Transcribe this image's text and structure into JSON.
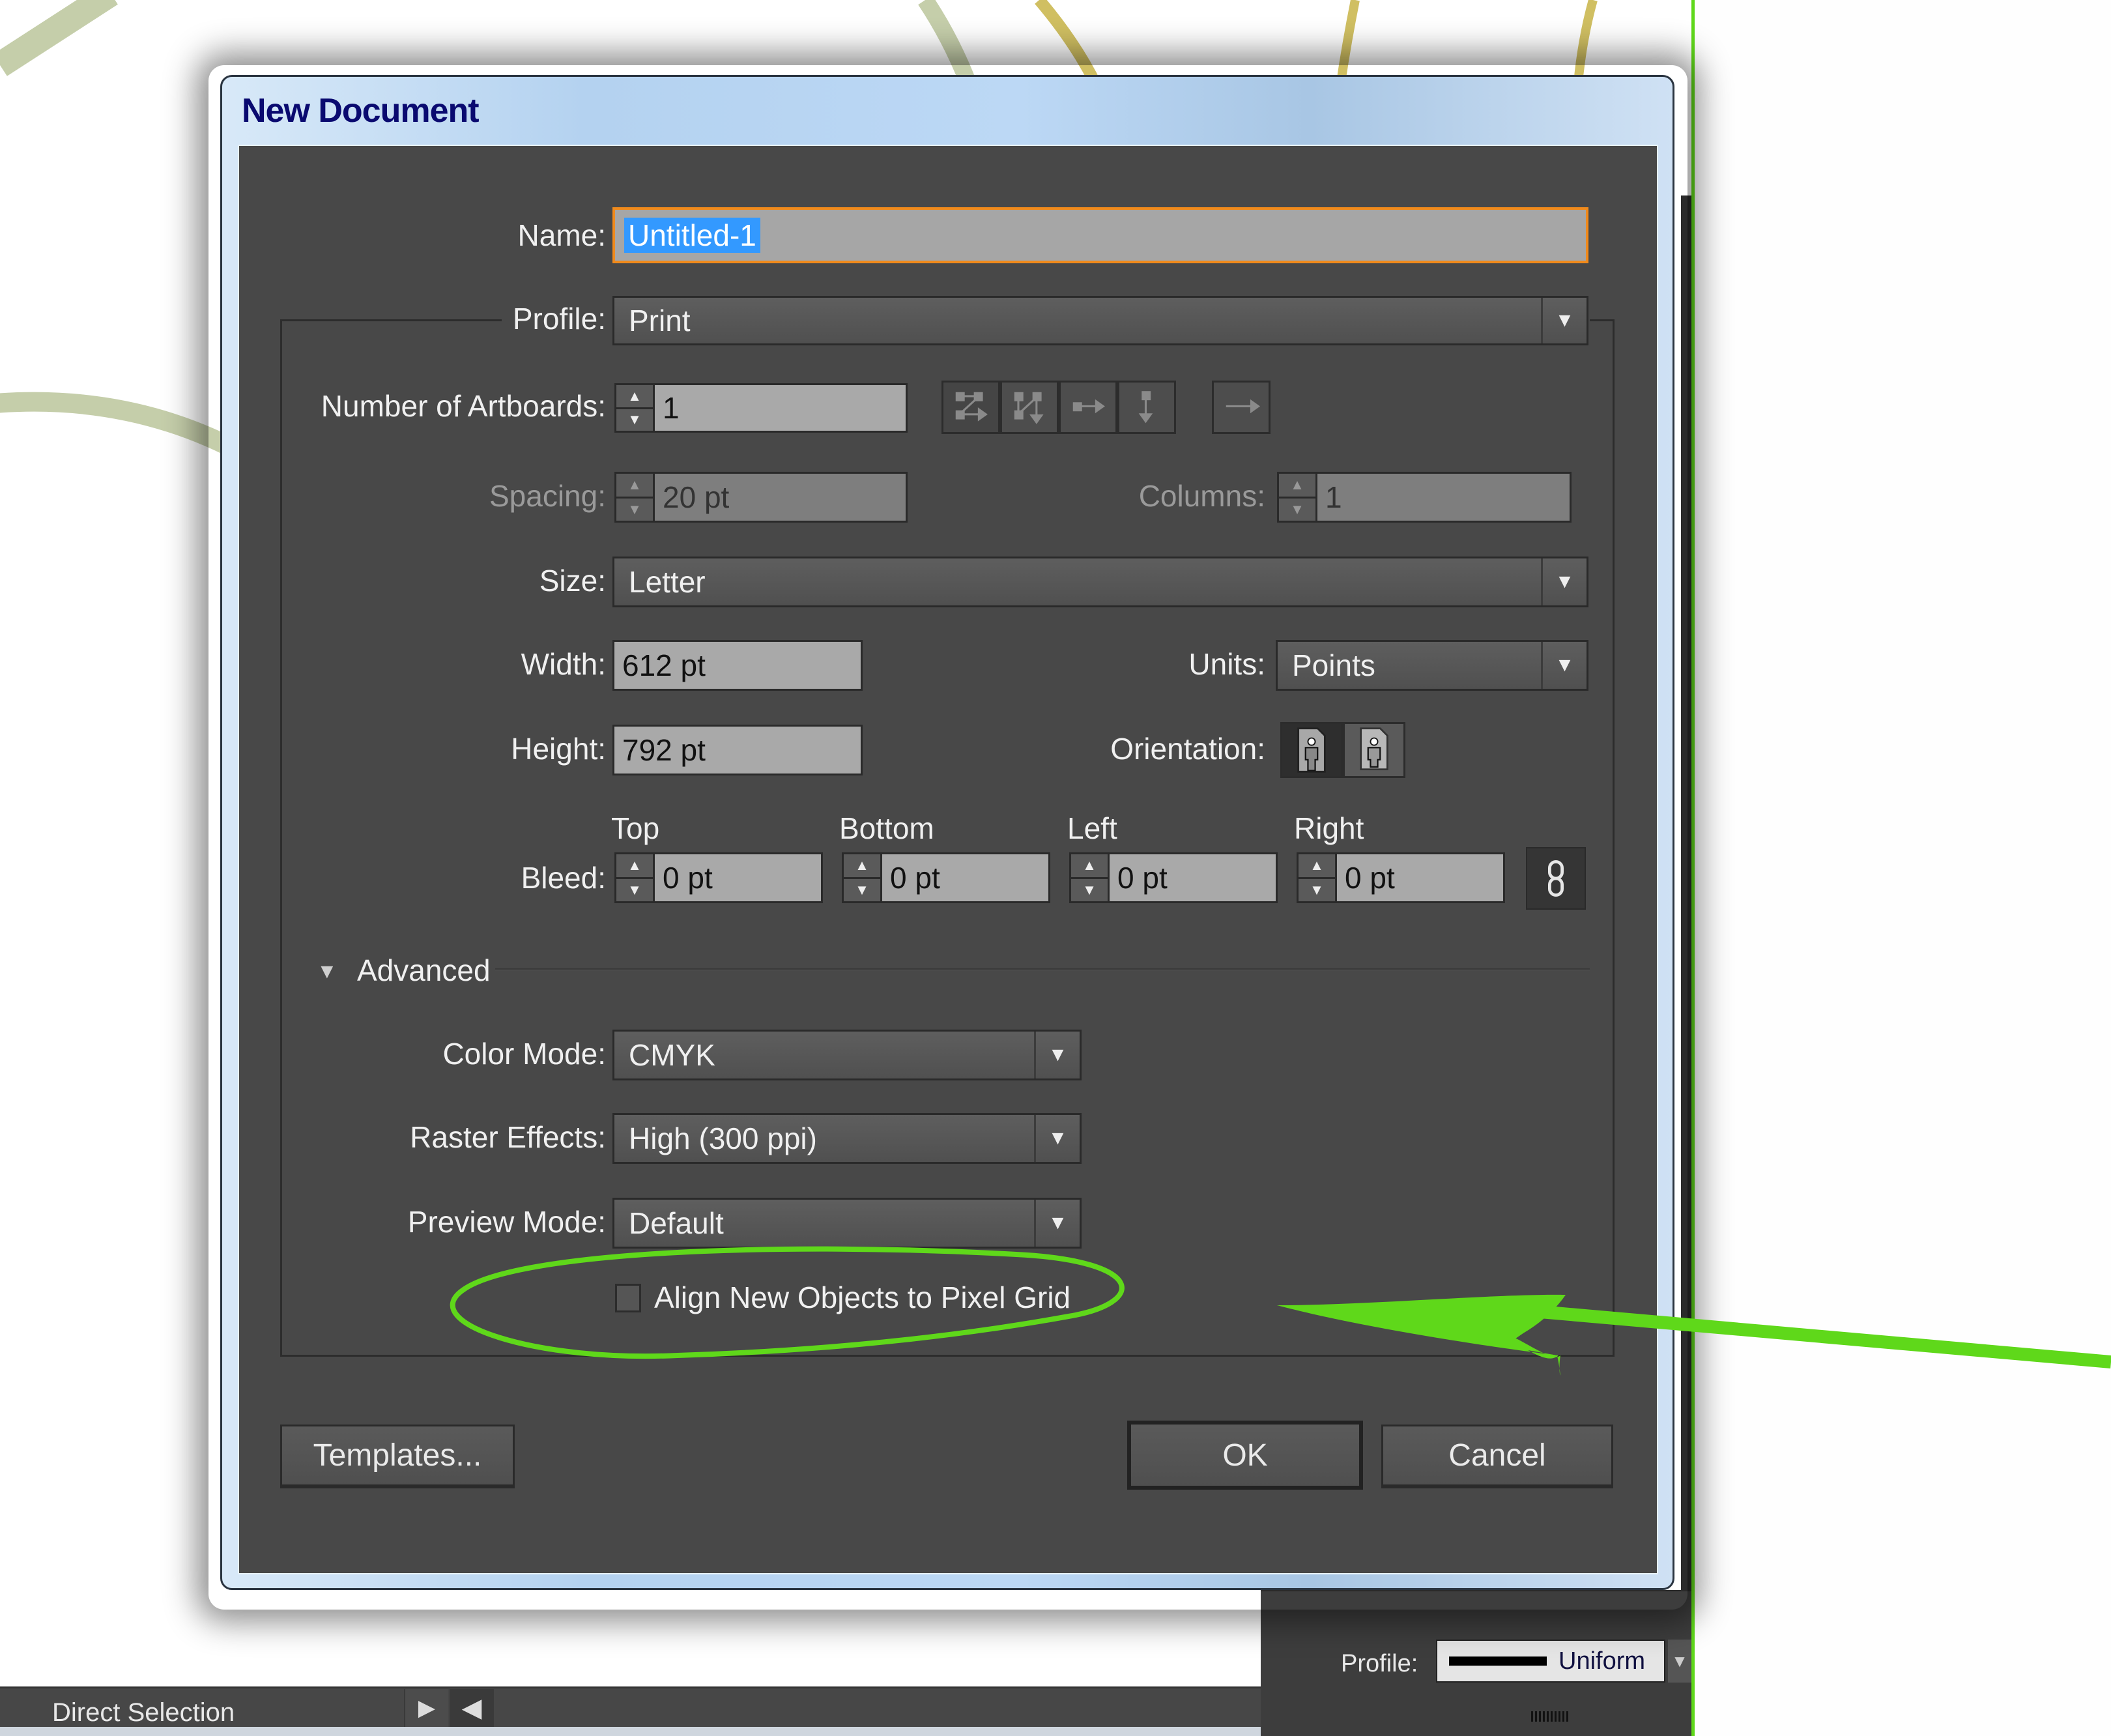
{
  "dialog": {
    "title": "New Document",
    "name": {
      "label": "Name:",
      "value": "Untitled-1"
    },
    "profile": {
      "label": "Profile:",
      "value": "Print"
    },
    "artboards": {
      "label": "Number of Artboards:",
      "value": "1",
      "layout_icons": [
        "grid-by-row-icon",
        "grid-by-column-icon",
        "arrange-by-row-icon",
        "arrange-by-column-icon",
        "right-to-left-layout-icon"
      ]
    },
    "spacing": {
      "label": "Spacing:",
      "value": "20 pt"
    },
    "columns": {
      "label": "Columns:",
      "value": "1"
    },
    "size": {
      "label": "Size:",
      "value": "Letter"
    },
    "width": {
      "label": "Width:",
      "value": "612 pt"
    },
    "units": {
      "label": "Units:",
      "value": "Points"
    },
    "height": {
      "label": "Height:",
      "value": "792 pt"
    },
    "orientation": {
      "label": "Orientation:",
      "selected": "portrait"
    },
    "bleed": {
      "label": "Bleed:",
      "top": {
        "label": "Top",
        "value": "0 pt"
      },
      "bottom": {
        "label": "Bottom",
        "value": "0 pt"
      },
      "left": {
        "label": "Left",
        "value": "0 pt"
      },
      "right": {
        "label": "Right",
        "value": "0 pt"
      }
    },
    "advanced": {
      "label": "Advanced",
      "expanded": true,
      "color_mode": {
        "label": "Color Mode:",
        "value": "CMYK"
      },
      "raster_effects": {
        "label": "Raster Effects:",
        "value": "High (300 ppi)"
      },
      "preview_mode": {
        "label": "Preview Mode:",
        "value": "Default"
      },
      "align_pixel_grid": {
        "label": "Align New Objects to Pixel Grid",
        "checked": false
      }
    },
    "buttons": {
      "templates": "Templates...",
      "ok": "OK",
      "cancel": "Cancel"
    }
  },
  "status_bar": {
    "tool": "Direct Selection"
  },
  "stroke_panel": {
    "profile_label": "Profile:",
    "profile_value": "Uniform"
  },
  "colors": {
    "annotation_green": "#5fd81a",
    "dialog_bg": "#484848",
    "title_text": "#0a0a70",
    "focus_border": "#f08a1c",
    "selection_blue": "#3399ff"
  }
}
